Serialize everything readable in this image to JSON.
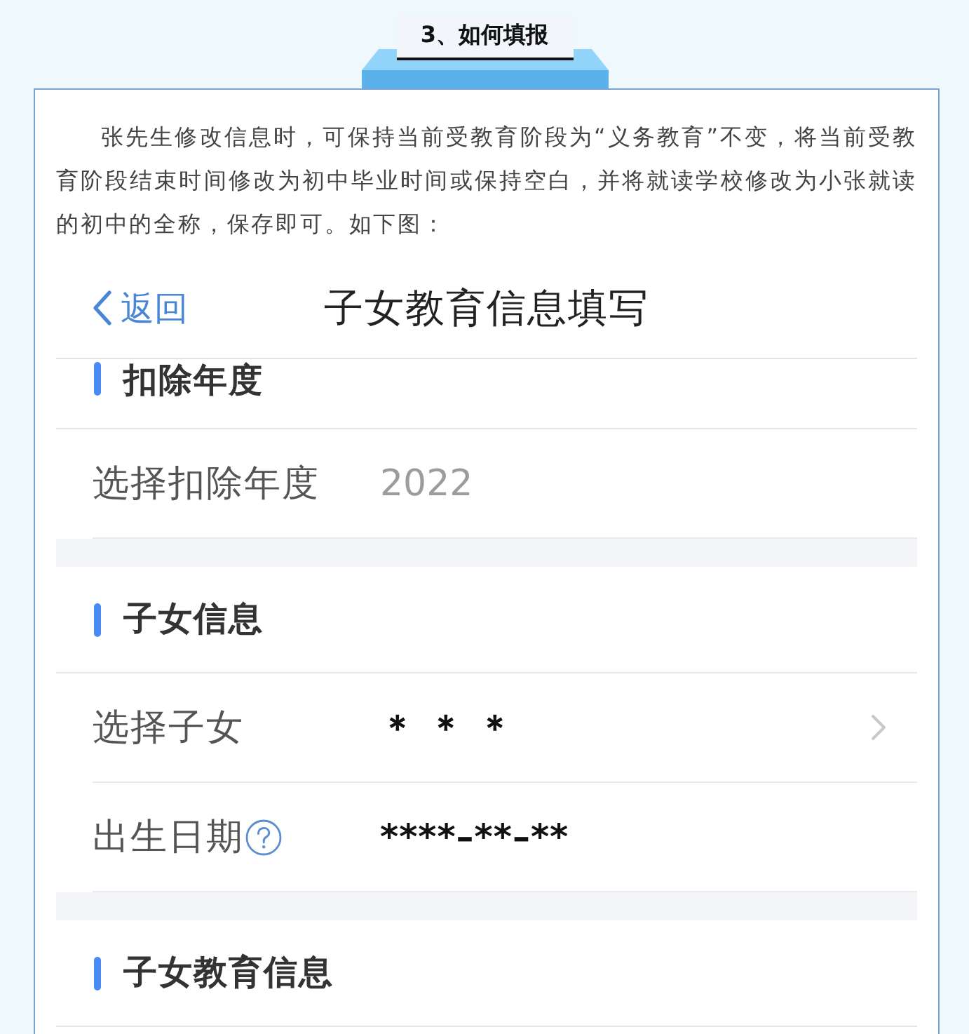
{
  "heading": {
    "title": "3、如何填报"
  },
  "intro": "张先生修改信息时，可保持当前受教育阶段为“义务教育”不变，将当前受教育阶段结束时间修改为初中毕业时间或保持空白，并将就读学校修改为小张就读的初中的全称，保存即可。如下图：",
  "screen": {
    "nav_bar": {
      "back_label": "返回",
      "title": "子女教育信息填写"
    },
    "sections": [
      {
        "title": "扣除年度",
        "rows": [
          {
            "kind": "readonly",
            "label": "选择扣除年度",
            "value": "2022"
          }
        ]
      },
      {
        "title": "子女信息",
        "rows": [
          {
            "kind": "picker",
            "label": "选择子女",
            "value": "＊ ＊ ＊"
          },
          {
            "kind": "help",
            "label": "出生日期",
            "value": "****–**–**"
          }
        ]
      },
      {
        "title": "子女教育信息"
      }
    ]
  }
}
